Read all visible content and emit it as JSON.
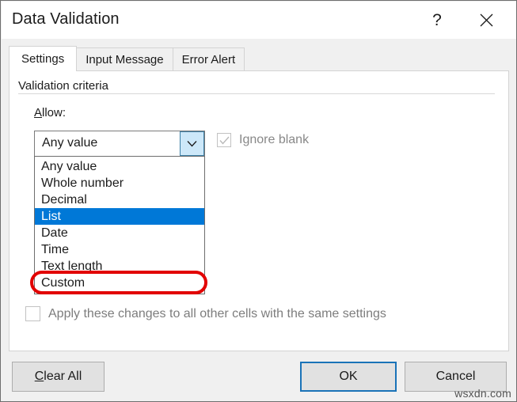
{
  "dialog": {
    "title": "Data Validation",
    "help_icon": "question-mark-icon",
    "help_label": "?",
    "close_icon": "close-icon"
  },
  "tabs": [
    {
      "label": "Settings",
      "active": true
    },
    {
      "label": "Input Message",
      "active": false
    },
    {
      "label": "Error Alert",
      "active": false
    }
  ],
  "settings": {
    "group_label": "Validation criteria",
    "allow_label_prefix": "A",
    "allow_label_rest": "llow:",
    "combo": {
      "value": "Any value",
      "arrow_icon": "chevron-down-icon",
      "expanded": true
    },
    "allow_options": [
      "Any value",
      "Whole number",
      "Decimal",
      "List",
      "Date",
      "Time",
      "Text length",
      "Custom"
    ],
    "selected_option": "List",
    "ignore_blank": {
      "label": "Ignore blank",
      "checked": true,
      "disabled": true,
      "check_icon": "checkmark-icon"
    },
    "apply_all": {
      "label": "Apply these changes to all other cells with the same settings",
      "checked": false,
      "disabled": true
    }
  },
  "footer": {
    "clear_all_prefix": "C",
    "clear_all_rest": "lear All",
    "ok_label": "OK",
    "cancel_label": "Cancel"
  },
  "watermark": "wsxdn.com",
  "colors": {
    "selection_blue": "#0078d7",
    "annotation_red": "#e20000",
    "focus_blue": "#1a73b8",
    "combo_arrow_bg": "#cde8f9"
  }
}
